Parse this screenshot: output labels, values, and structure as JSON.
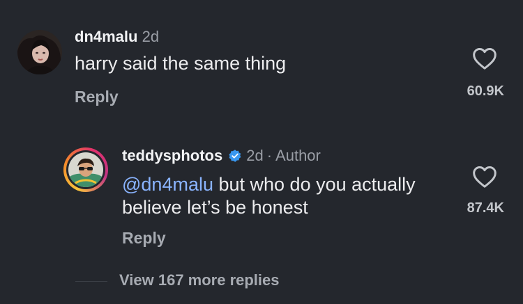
{
  "comments": [
    {
      "username": "dn4malu",
      "age": "2d",
      "text": "harry said the same thing",
      "reply_label": "Reply",
      "like_count": "60.9K",
      "like_icon": "heart-outline-icon"
    }
  ],
  "reply": {
    "username": "teddysphotos",
    "verified": true,
    "age": "2d",
    "separator": "·",
    "badge": "Author",
    "mention": "@dn4malu",
    "text": " but who do you actually believe let’s be honest",
    "reply_label": "Reply",
    "like_count": "87.4K",
    "like_icon": "heart-outline-icon"
  },
  "view_more": {
    "label": "View 167 more replies"
  },
  "colors": {
    "background": "#24272d",
    "mention": "#8ab4ff",
    "verified": "#3897f0",
    "muted": "#9a9ea6"
  }
}
